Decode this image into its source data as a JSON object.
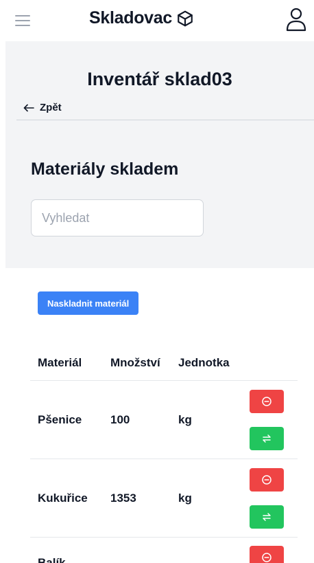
{
  "header": {
    "brand": "Skladovac",
    "brand_icon": "box-icon",
    "menu_icon": "hamburger-icon",
    "user_icon": "user-icon"
  },
  "page": {
    "title": "Inventář sklad03",
    "back_label": "Zpět",
    "back_icon": "arrow-left-icon"
  },
  "materials": {
    "section_title": "Materiály skladem",
    "search_placeholder": "Vyhledat",
    "add_button": "Naskladnit materiál",
    "columns": [
      "Materiál",
      "Množství",
      "Jednotka"
    ],
    "rows": [
      {
        "name": "Pšenice",
        "quantity": "100",
        "unit": "kg"
      },
      {
        "name": "Kukuřice",
        "quantity": "1353",
        "unit": "kg"
      },
      {
        "name": "Balík",
        "quantity": "",
        "unit": ""
      }
    ],
    "remove_icon": "minus-circle-icon",
    "transfer_icon": "transfer-arrows-icon"
  },
  "colors": {
    "primary": "#3b82f6",
    "danger": "#ef4444",
    "success": "#22c55e",
    "background": "#f3f4f6"
  }
}
